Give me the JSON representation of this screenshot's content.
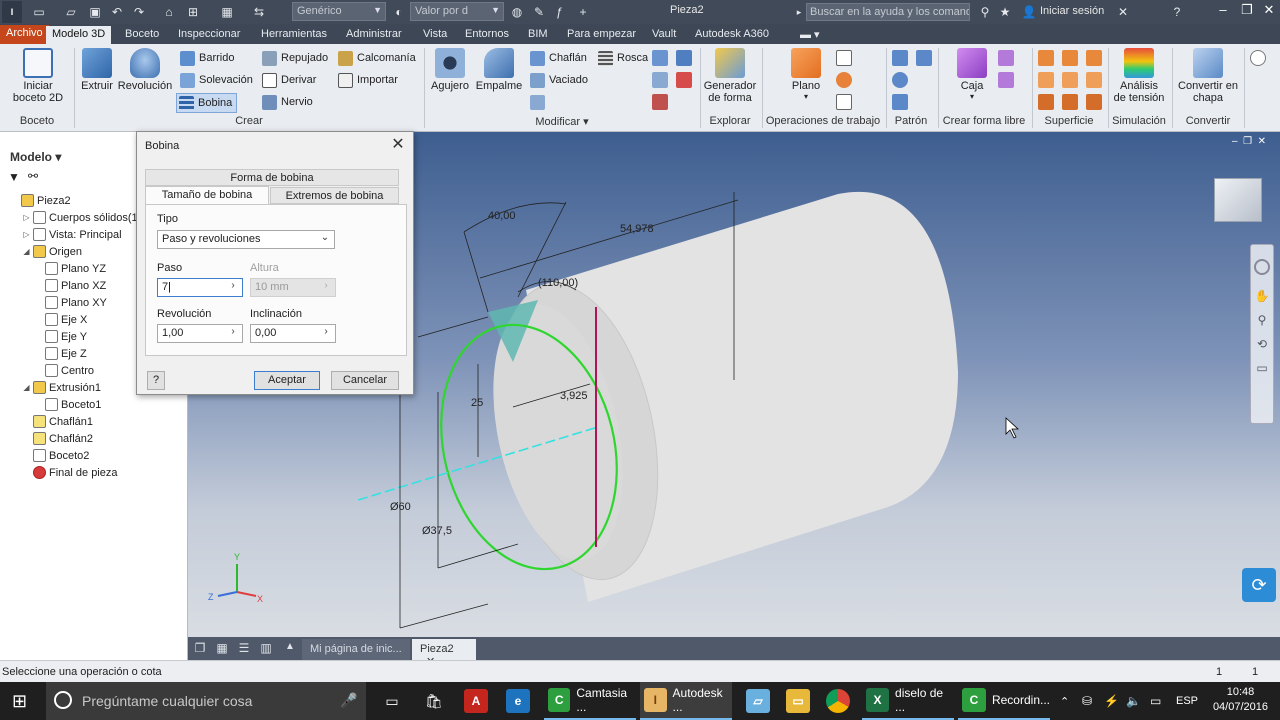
{
  "titlebar": {
    "material_combo": "Genérico",
    "appearance_combo": "Valor por d",
    "document_title": "Pieza2",
    "help_search_placeholder": "Buscar en la ayuda y los comandos",
    "signin": "Iniciar sesión",
    "icons": [
      "new-icon",
      "open-icon",
      "save-icon",
      "undo-icon",
      "redo-icon",
      "home-icon",
      "return-icon",
      "select-icon",
      "update-icon",
      "color-icon",
      "parameters-icon",
      "fx-icon",
      "plus-icon"
    ]
  },
  "tabs": [
    "Archivo",
    "Modelo 3D",
    "Boceto",
    "Inspeccionar",
    "Herramientas",
    "Administrar",
    "Vista",
    "Entornos",
    "BIM",
    "Para empezar",
    "Vault",
    "Autodesk A360"
  ],
  "ribbon": {
    "sketch": {
      "start_sketch": "Iniciar",
      "start_sketch_2": "boceto 2D",
      "panel": "Boceto"
    },
    "create": {
      "extrude": "Extruir",
      "revolve": "Revolución",
      "sweep": "Barrido",
      "loft": "Solevación",
      "coil": "Bobina",
      "emboss": "Repujado",
      "derive": "Derivar",
      "rib": "Nervio",
      "decal": "Calcomanía",
      "import": "Importar",
      "panel": "Crear"
    },
    "modify": {
      "hole": "Agujero",
      "fillet": "Empalme",
      "chamfer": "Chaflán",
      "shell": "Vaciado",
      "thread": "Rosca",
      "panel": "Modificar ▾"
    },
    "explore": {
      "generator": "Generador",
      "generator_2": "de forma",
      "panel": "Explorar"
    },
    "work": {
      "plane": "Plano",
      "panel": "Operaciones de trabajo"
    },
    "pattern": {
      "panel": "Patrón"
    },
    "freeform": {
      "box": "Caja",
      "panel": "Crear forma libre"
    },
    "surface": {
      "panel": "Superficie"
    },
    "simulation": {
      "stress": "Análisis",
      "stress_2": "de tensión",
      "panel": "Simulación"
    },
    "convert": {
      "sheet": "Convertir en",
      "sheet_2": "chapa",
      "panel": "Convertir"
    }
  },
  "browser": {
    "title": "Modelo ▾",
    "items": [
      {
        "label": "Pieza2",
        "indent": 0
      },
      {
        "label": "Cuerpos sólidos(1)",
        "indent": 1
      },
      {
        "label": "Vista: Principal",
        "indent": 1
      },
      {
        "label": "Origen",
        "indent": 1
      },
      {
        "label": "Plano YZ",
        "indent": 2
      },
      {
        "label": "Plano XZ",
        "indent": 2
      },
      {
        "label": "Plano XY",
        "indent": 2
      },
      {
        "label": "Eje X",
        "indent": 2
      },
      {
        "label": "Eje Y",
        "indent": 2
      },
      {
        "label": "Eje Z",
        "indent": 2
      },
      {
        "label": "Centro",
        "indent": 2
      },
      {
        "label": "Extrusión1",
        "indent": 1
      },
      {
        "label": "Boceto1",
        "indent": 2
      },
      {
        "label": "Chaflán1",
        "indent": 1
      },
      {
        "label": "Chaflán2",
        "indent": 1
      },
      {
        "label": "Boceto2",
        "indent": 1
      },
      {
        "label": "Final de pieza",
        "indent": 1
      }
    ]
  },
  "dialog": {
    "title": "Bobina",
    "tab_shape": "Forma de bobina",
    "tab_size": "Tamaño de bobina",
    "tab_ends": "Extremos de bobina",
    "type_label": "Tipo",
    "type_value": "Paso y revoluciones",
    "pitch_label": "Paso",
    "pitch_value": "7",
    "height_label": "Altura",
    "height_value": "10 mm",
    "rev_label": "Revolución",
    "rev_value": "1,00",
    "taper_label": "Inclinación",
    "taper_value": "0,00",
    "ok": "Aceptar",
    "cancel": "Cancelar",
    "help": "?"
  },
  "viewport": {
    "dims": [
      "40,00",
      "54,978",
      "(110,00)",
      "3,925",
      "25",
      "Ø60",
      "Ø37,5"
    ],
    "axis_labels": [
      "Y",
      "Z",
      "X"
    ]
  },
  "doctabs": {
    "home": "Mi página de inic...",
    "part": "Pieza2",
    "close": "✕"
  },
  "status": {
    "text": "Seleccione una operación o cota",
    "n1": "1",
    "n2": "1"
  },
  "taskbar": {
    "search": "Pregúntame cualquier cosa",
    "apps": [
      "Camtasia ...",
      "Autodesk ...",
      "diselo de ...",
      "Recordin..."
    ],
    "lang": "ESP",
    "time": "10:48",
    "date": "04/07/2016"
  },
  "colors": {
    "accent_file": "#c4461a",
    "coil_green": "#2fd62f",
    "titlebar": "#404a58"
  }
}
